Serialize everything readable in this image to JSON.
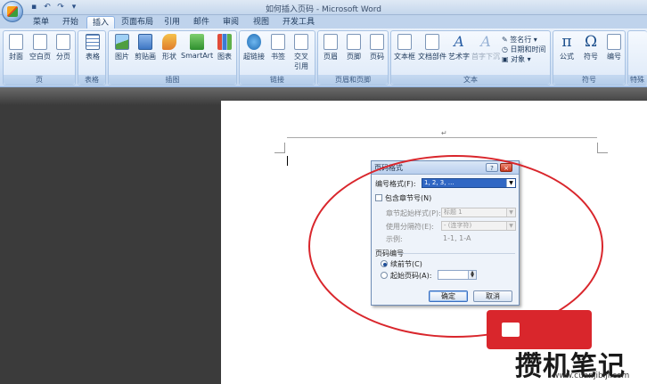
{
  "window": {
    "title": "如何插入页码 - Microsoft Word"
  },
  "tabs": [
    {
      "label": "菜单"
    },
    {
      "label": "开始"
    },
    {
      "label": "插入"
    },
    {
      "label": "页面布局"
    },
    {
      "label": "引用"
    },
    {
      "label": "邮件"
    },
    {
      "label": "审阅"
    },
    {
      "label": "视图"
    },
    {
      "label": "开发工具"
    }
  ],
  "ribbon": {
    "pages": {
      "label": "页",
      "cover": "封面",
      "blank": "空白页",
      "break": "分页"
    },
    "tables": {
      "label": "表格",
      "table": "表格"
    },
    "illustrations": {
      "label": "插图",
      "picture": "图片",
      "clipart": "剪贴画",
      "shapes": "形状",
      "smartart": "SmartArt",
      "chart": "图表"
    },
    "links": {
      "label": "链接",
      "hyperlink": "超链接",
      "bookmark": "书签",
      "crossref_1": "交叉",
      "crossref_2": "引用"
    },
    "header_footer": {
      "label": "页眉和页脚",
      "header": "页眉",
      "footer": "页脚",
      "page_number": "页码"
    },
    "text": {
      "label": "文本",
      "textbox": "文本框",
      "quickparts": "文档部件",
      "wordart": "艺术字",
      "dropcap": "首字下沉",
      "signature": "签名行",
      "datetime": "日期和时间",
      "object": "对象"
    },
    "symbols": {
      "label": "符号",
      "equation": "公式",
      "symbol": "符号",
      "number": "编号"
    },
    "special": {
      "label": "特殊"
    }
  },
  "document": {
    "para_mark": "↵"
  },
  "dialog": {
    "title": "页码格式",
    "help": "?",
    "close": "×",
    "number_format_label": "编号格式(F):",
    "number_format_value": "1, 2, 3, …",
    "include_chapter_label": "包含章节号(N)",
    "chapter_style_label": "章节起始样式(P):",
    "chapter_style_value": "标题 1",
    "separator_label": "使用分隔符(E):",
    "separator_value": "-  (连字符)",
    "example_label": "示例:",
    "example_value": "1-1, 1-A",
    "page_numbering_label": "页码编号",
    "continue_label": "续前节(C)",
    "start_at_label": "起始页码(A):",
    "start_at_value": "",
    "ok": "确定",
    "cancel": "取消"
  },
  "watermark": {
    "name": "攒机笔记",
    "url": "www.cuanjibiji.com"
  },
  "colors": {
    "accent_red": "#d9262c",
    "ribbon_blue": "#cfe0f5"
  }
}
